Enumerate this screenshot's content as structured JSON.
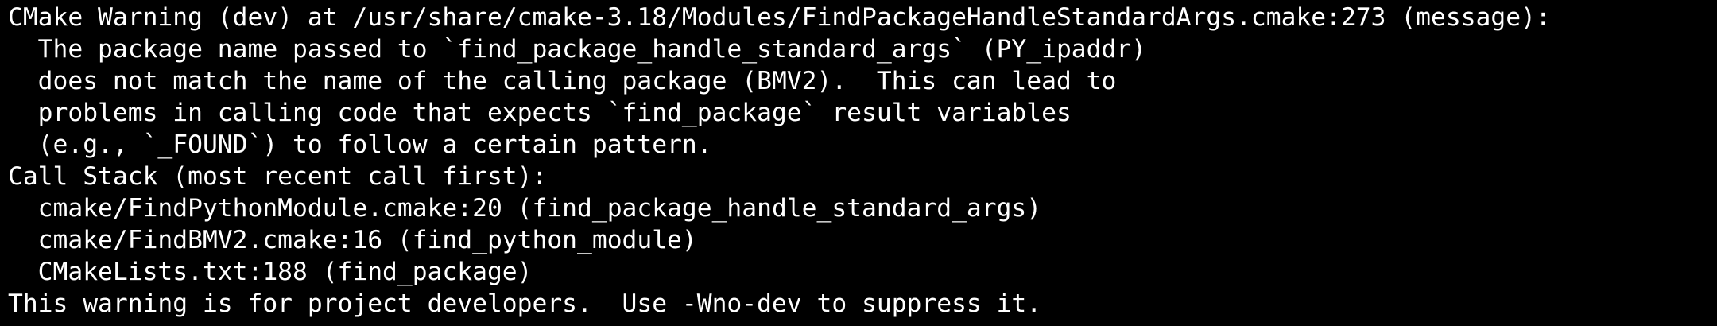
{
  "terminal": {
    "background": "#000000",
    "foreground": "#ffffff",
    "lines": [
      "CMake Warning (dev) at /usr/share/cmake-3.18/Modules/FindPackageHandleStandardArgs.cmake:273 (message):",
      "  The package name passed to `find_package_handle_standard_args` (PY_ipaddr)",
      "  does not match the name of the calling package (BMV2).  This can lead to",
      "  problems in calling code that expects `find_package` result variables",
      "  (e.g., `_FOUND`) to follow a certain pattern.",
      "Call Stack (most recent call first):",
      "  cmake/FindPythonModule.cmake:20 (find_package_handle_standard_args)",
      "  cmake/FindBMV2.cmake:16 (find_python_module)",
      "  CMakeLists.txt:188 (find_package)",
      "This warning is for project developers.  Use -Wno-dev to suppress it."
    ]
  }
}
